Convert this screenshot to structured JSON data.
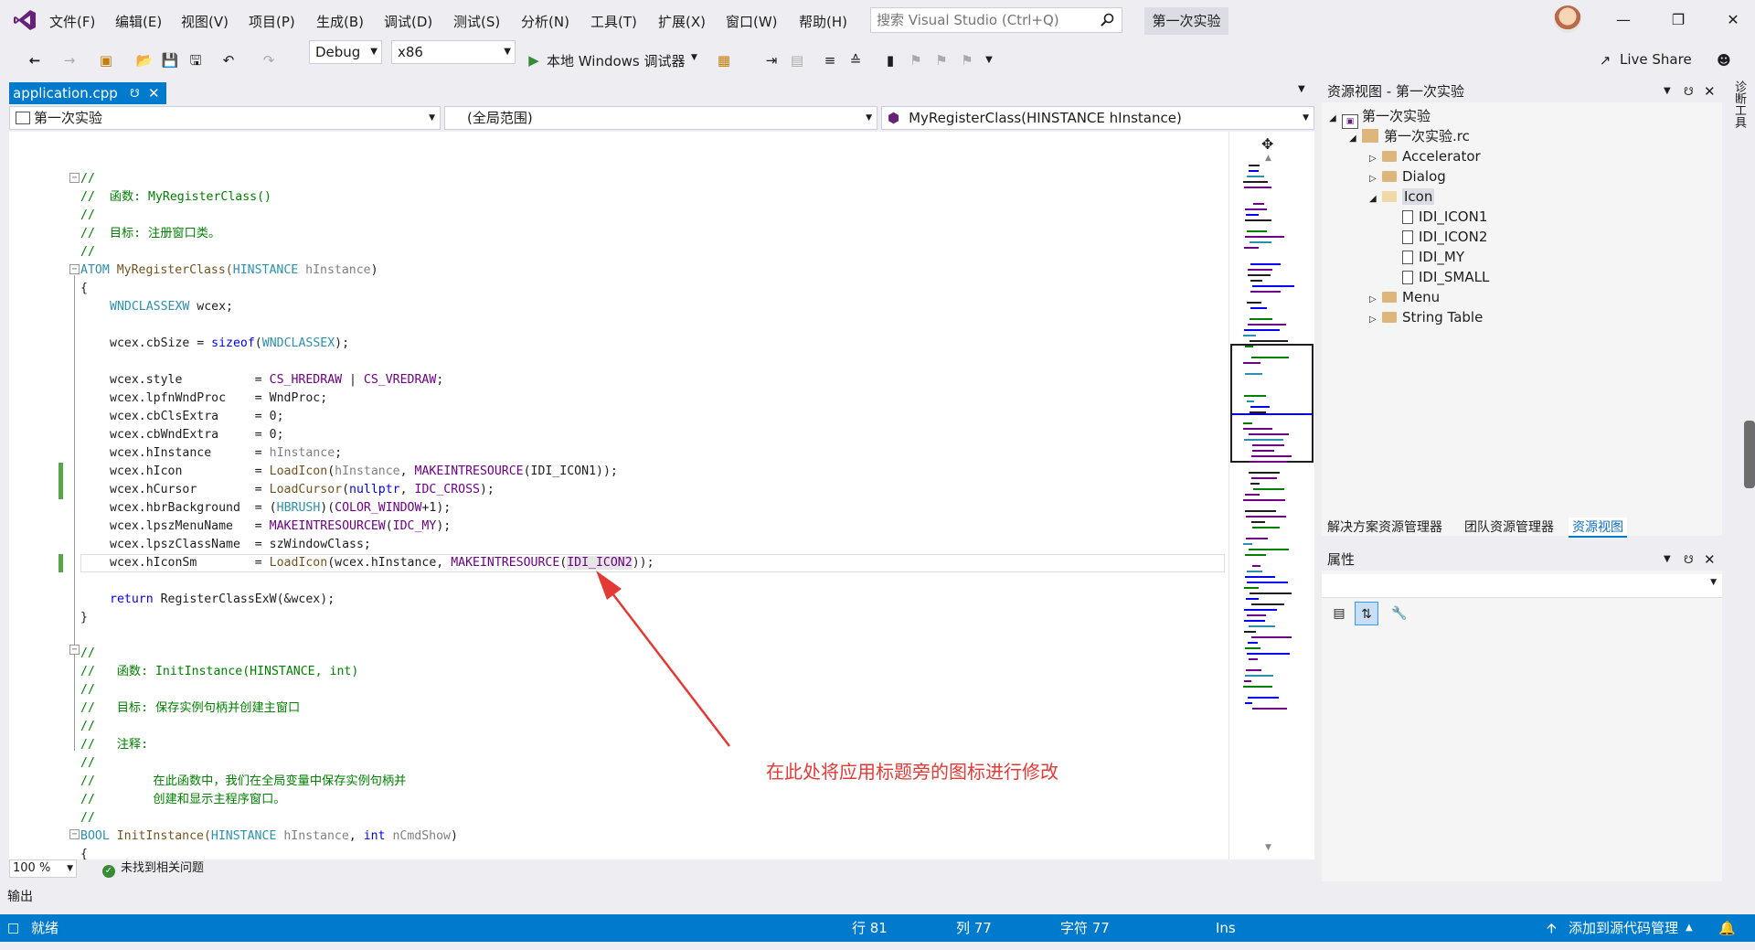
{
  "menu": {
    "items": [
      "文件(F)",
      "编辑(E)",
      "视图(V)",
      "项目(P)",
      "生成(B)",
      "调试(D)",
      "测试(S)",
      "分析(N)",
      "工具(T)",
      "扩展(X)",
      "窗口(W)",
      "帮助(H)"
    ]
  },
  "search": {
    "placeholder": "搜索 Visual Studio (Ctrl+Q)"
  },
  "solution_badge": "第一次实验",
  "live_share": "Live Share",
  "toolbar": {
    "config": "Debug",
    "platform": "x86",
    "debugger": "本地 Windows 调试器"
  },
  "doc_tab": {
    "label": "application.cpp"
  },
  "nav": {
    "project": "第一次实验",
    "scope": "(全局范围)",
    "member": "MyRegisterClass(HINSTANCE hInstance)"
  },
  "code": {
    "l1": "//",
    "l2": "//  函数: MyRegisterClass()",
    "l3": "//",
    "l4": "//  目标: 注册窗口类。",
    "l5": "//",
    "l6_kw": "ATOM",
    "l6_fn": " MyRegisterClass(",
    "l6_ty": "HINSTANCE",
    "l6_p": " hInstance",
    "l6_end": ")",
    "l7": "{",
    "l8_ty": "WNDCLASSEXW",
    "l8_rest": " wcex;",
    "l9_a": "wcex.cbSize = ",
    "l9_kw": "sizeof",
    "l9_b": "(",
    "l9_ty": "WNDCLASSEX",
    "l9_c": ");",
    "l10_a": "wcex.style          = ",
    "l10_m1": "CS_HREDRAW",
    "l10_b": " | ",
    "l10_m2": "CS_VREDRAW",
    "l10_c": ";",
    "l11": "wcex.lpfnWndProc    = WndProc;",
    "l12": "wcex.cbClsExtra     = 0;",
    "l13": "wcex.cbWndExtra     = 0;",
    "l14_a": "wcex.hInstance      = ",
    "l14_p": "hInstance",
    "l14_b": ";",
    "l15_a": "wcex.hIcon          = ",
    "l15_fn": "LoadIcon",
    "l15_b": "(",
    "l15_p": "hInstance",
    "l15_c": ", ",
    "l15_m": "MAKEINTRESOURCE",
    "l15_d": "(IDI_ICON1));",
    "l16_a": "wcex.hCursor        = ",
    "l16_fn": "LoadCursor",
    "l16_b": "(",
    "l16_kw": "nullptr",
    "l16_c": ", ",
    "l16_m": "IDC_CROSS",
    "l16_d": ");",
    "l17_a": "wcex.hbrBackground  = (",
    "l17_ty": "HBRUSH",
    "l17_b": ")(",
    "l17_m": "COLOR_WINDOW",
    "l17_c": "+1);",
    "l18_a": "wcex.lpszMenuName   = ",
    "l18_m": "MAKEINTRESOURCEW",
    "l18_b": "(",
    "l18_m2": "IDC_MY",
    "l18_c": ");",
    "l19": "wcex.lpszClassName  = szWindowClass;",
    "l20_a": "wcex.hIconSm        = ",
    "l20_fn": "LoadIcon",
    "l20_b": "(wcex.hInstance, ",
    "l20_m": "MAKEINTRESOURCE",
    "l20_c": "(",
    "l20_id": "IDI_ICON2",
    "l20_d": "));",
    "l21_kw": "return",
    "l21_rest": " RegisterClassExW(&wcex);",
    "l22": "}",
    "l23": "//",
    "l24": "//   函数: InitInstance(HINSTANCE, int)",
    "l25": "//",
    "l26": "//   目标: 保存实例句柄并创建主窗口",
    "l27": "//",
    "l28": "//   注释:",
    "l29": "//",
    "l30": "//        在此函数中，我们在全局变量中保存实例句柄并",
    "l31": "//        创建和显示主程序窗口。",
    "l32": "//",
    "l33_kw": "BOOL",
    "l33_fn": " InitInstance(",
    "l33_ty": "HINSTANCE",
    "l33_p": " hInstance",
    "l33_b": ", ",
    "l33_kw2": "int",
    "l33_p2": " nCmdShow",
    "l33_c": ")",
    "l34": "{"
  },
  "annotation": "在此处将应用标题旁的图标进行修改",
  "zoom": "100 %",
  "issues": "未找到相关问题",
  "output_label": "输出",
  "status": {
    "ready": "就绪",
    "line": "行 81",
    "col": "列 77",
    "char": "字符 77",
    "mode": "Ins",
    "source_control": "添加到源代码管理"
  },
  "resource_view": {
    "title": "资源视图 - 第一次实验",
    "tree": {
      "project": "第一次实验",
      "rc": "第一次实验.rc",
      "accelerator": "Accelerator",
      "dialog": "Dialog",
      "icon": "Icon",
      "icons": [
        "IDI_ICON1",
        "IDI_ICON2",
        "IDI_MY",
        "IDI_SMALL"
      ],
      "menu": "Menu",
      "string_table": "String Table"
    }
  },
  "pane_tabs": [
    "解决方案资源管理器",
    "团队资源管理器",
    "资源视图"
  ],
  "properties": {
    "title": "属性"
  },
  "diag_tab": "诊断工具",
  "colors": {
    "accent": "#007acc",
    "annotation": "#e53935",
    "comment": "#008000",
    "keyword": "#0000ff",
    "macro": "#6f008a",
    "type": "#2b91af"
  }
}
